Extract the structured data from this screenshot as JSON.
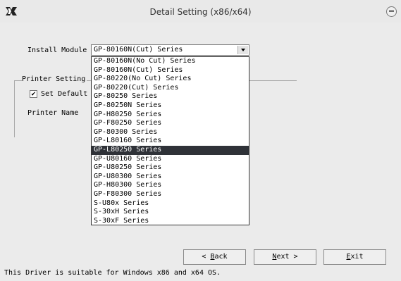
{
  "window": {
    "title": "Detail Setting (x86/x64)"
  },
  "install_module": {
    "label": "Install Module",
    "selected": "GP-80160N(Cut) Series"
  },
  "printer_setting": {
    "group_label": "Printer Setting",
    "set_default_label": "Set Default",
    "set_default_checked": true,
    "check_glyph": "✔",
    "printer_name_label": "Printer Name"
  },
  "dropdown": {
    "items": [
      "GP-80160N(No Cut) Series",
      "GP-80160N(Cut) Series",
      "GP-80220(No Cut) Series",
      "GP-80220(Cut) Series",
      "GP-80250 Series",
      "GP-80250N Series",
      "GP-H80250 Series",
      "GP-F80250 Series",
      "GP-80300 Series",
      "GP-L80160 Series",
      "GP-L80250 Series",
      "GP-U80160 Series",
      "GP-U80250 Series",
      "GP-U80300 Series",
      "GP-H80300 Series",
      "GP-F80300 Series",
      "S-U80x Series",
      "S-30xH Series",
      "S-30xF Series"
    ],
    "highlighted_index": 10
  },
  "buttons": {
    "back": {
      "prefix": "< ",
      "mnemonic": "B",
      "rest": "ack"
    },
    "next": {
      "mnemonic": "N",
      "rest": "ext >"
    },
    "exit": {
      "mnemonic": "E",
      "rest": "xit"
    }
  },
  "status_text": "This Driver is suitable for Windows x86 and x64 OS.",
  "icons": {
    "app": "printer-app-icon",
    "close": "close-icon",
    "dropdown_arrow": "chevron-down-icon",
    "checkbox": "check-icon"
  }
}
